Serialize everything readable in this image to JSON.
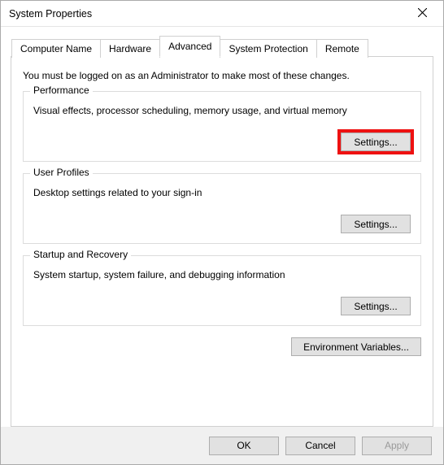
{
  "window": {
    "title": "System Properties"
  },
  "tabs": {
    "computer_name": "Computer Name",
    "hardware": "Hardware",
    "advanced": "Advanced",
    "system_protection": "System Protection",
    "remote": "Remote"
  },
  "advanced_panel": {
    "intro": "You must be logged on as an Administrator to make most of these changes.",
    "performance": {
      "title": "Performance",
      "desc": "Visual effects, processor scheduling, memory usage, and virtual memory",
      "settings_label": "Settings..."
    },
    "user_profiles": {
      "title": "User Profiles",
      "desc": "Desktop settings related to your sign-in",
      "settings_label": "Settings..."
    },
    "startup_recovery": {
      "title": "Startup and Recovery",
      "desc": "System startup, system failure, and debugging information",
      "settings_label": "Settings..."
    },
    "env_vars_label": "Environment Variables..."
  },
  "footer": {
    "ok": "OK",
    "cancel": "Cancel",
    "apply": "Apply"
  }
}
